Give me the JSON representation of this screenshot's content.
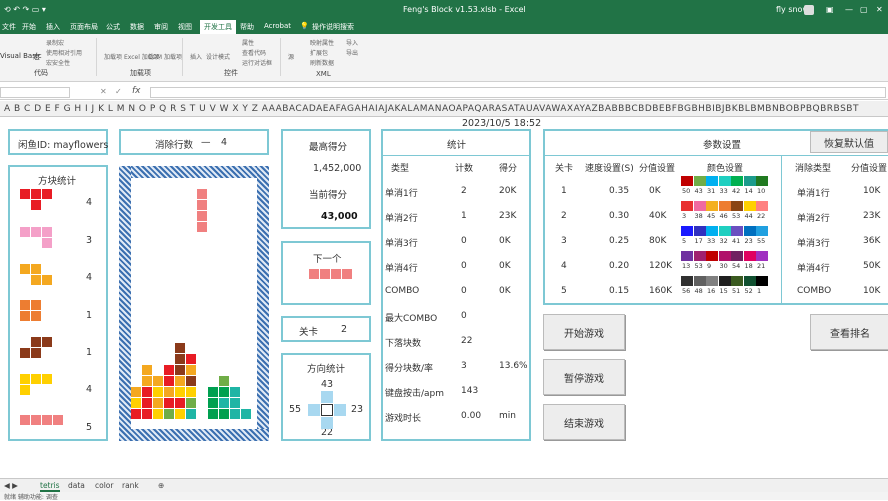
{
  "app": {
    "title": "Feng's Block v1.53.xlsb  -  Excel",
    "user": "fly snow"
  },
  "ribbon_tabs": [
    "文件",
    "开始",
    "插入",
    "页面布局",
    "公式",
    "数据",
    "审阅",
    "视图",
    "开发工具",
    "帮助",
    "Acrobat",
    "操作说明搜索"
  ],
  "ribbon": {
    "groups": [
      "代码",
      "加载项",
      "控件",
      "XML"
    ],
    "items": [
      "Visual Basic",
      "宏",
      "录制宏",
      "使用相对引用",
      "宏安全性",
      "加载项",
      "Excel 加载项",
      "COM 加载项",
      "插入",
      "设计模式",
      "属性",
      "查看代码",
      "运行对话框",
      "源",
      "映射属性",
      "扩展包",
      "刷新数据",
      "导入",
      "导出"
    ]
  },
  "formula_bar": {
    "fx": "fx"
  },
  "col_header": "A B C D E F G H I J K L M N O P Q R S T U V W X Y Z AAABACADAEAFAGAHAIAJAKALAMANAOAPAQARASATAUAVAWAXAYAZBABBBCBDBEBFBGBHBIBJBKBLBMBNBOBPBQBRBSBT",
  "player": {
    "label": "闲鱼ID: mayflowers"
  },
  "lines": {
    "label": "消除行数",
    "sep": "—",
    "value": "4"
  },
  "piece_stats": {
    "title": "方块统计",
    "counts": [
      "4",
      "3",
      "4",
      "1",
      "1",
      "4",
      "5"
    ]
  },
  "high": {
    "label": "最高得分",
    "value": "1,452,000",
    "cur_label": "当前得分",
    "cur_value": "43,000"
  },
  "next": {
    "label": "下一个"
  },
  "level": {
    "label": "关卡",
    "value": "2"
  },
  "dir": {
    "label": "方向统计",
    "up": "43",
    "left": "55",
    "right": "23",
    "down": "22"
  },
  "datetime": "2023/10/5 18:52",
  "stats": {
    "title": "统计",
    "headers": [
      "类型",
      "计数",
      "得分"
    ],
    "rows": [
      [
        "单消1行",
        "2",
        "20K"
      ],
      [
        "单消2行",
        "1",
        "23K"
      ],
      [
        "单消3行",
        "0",
        "0K"
      ],
      [
        "单消4行",
        "0",
        "0K"
      ],
      [
        "COMBO",
        "0",
        "0K"
      ],
      [
        "最大COMBO",
        "0",
        ""
      ],
      [
        "下落块数",
        "22",
        ""
      ],
      [
        "得分块数/率",
        "3",
        "13.6%"
      ],
      [
        "键盘按击/apm",
        "143",
        ""
      ],
      [
        "游戏时长",
        "0.00",
        "min"
      ]
    ]
  },
  "settings": {
    "title": "参数设置",
    "reset": "恢复默认值",
    "headers": [
      "关卡",
      "速度设置(S)",
      "分值设置",
      "颜色设置",
      "消除类型",
      "分值设置"
    ],
    "rows": [
      {
        "level": "1",
        "speed": "0.35",
        "score": "0K",
        "type": "单消1行",
        "type_score": "10K",
        "nums": [
          "50",
          "43",
          "31",
          "33",
          "42",
          "14",
          "10"
        ],
        "colors": [
          "#c00000",
          "#70ad47",
          "#00b0f0",
          "#1fcfc0",
          "#00b050",
          "#1c9c8c",
          "#217a21"
        ]
      },
      {
        "level": "2",
        "speed": "0.30",
        "score": "40K",
        "type": "单消2行",
        "type_score": "23K",
        "nums": [
          "3",
          "38",
          "45",
          "46",
          "53",
          "44",
          "22"
        ],
        "colors": [
          "#e83030",
          "#f06aa0",
          "#f4b020",
          "#ed7d31",
          "#8b4513",
          "#ffd000",
          "#ff8080"
        ]
      },
      {
        "level": "3",
        "speed": "0.25",
        "score": "80K",
        "type": "单消3行",
        "type_score": "36K",
        "nums": [
          "5",
          "17",
          "33",
          "32",
          "41",
          "23",
          "55"
        ],
        "colors": [
          "#1a1aff",
          "#3030c0",
          "#00b0f0",
          "#1fcfc0",
          "#6a4fc0",
          "#0070c0",
          "#20a0e0"
        ]
      },
      {
        "level": "4",
        "speed": "0.20",
        "score": "120K",
        "type": "单消4行",
        "type_score": "50K",
        "nums": [
          "13",
          "53",
          "9",
          "30",
          "54",
          "18",
          "21"
        ],
        "colors": [
          "#7030a0",
          "#a02070",
          "#c00000",
          "#b0106a",
          "#702060",
          "#e00060",
          "#a030c0"
        ]
      },
      {
        "level": "5",
        "speed": "0.15",
        "score": "160K",
        "type": "COMBO",
        "type_score": "10K",
        "nums": [
          "56",
          "48",
          "16",
          "15",
          "51",
          "52",
          "1"
        ],
        "colors": [
          "#303030",
          "#606060",
          "#808080",
          "#202020",
          "#3a5a20",
          "#105030",
          "#000000"
        ]
      }
    ]
  },
  "buttons": {
    "start": "开始游戏",
    "pause": "暂停游戏",
    "end": "结束游戏",
    "rank": "查看排名"
  },
  "sheets": [
    "tetris",
    "data",
    "color",
    "rank"
  ],
  "status": "就绪  辅助功能: 调查"
}
